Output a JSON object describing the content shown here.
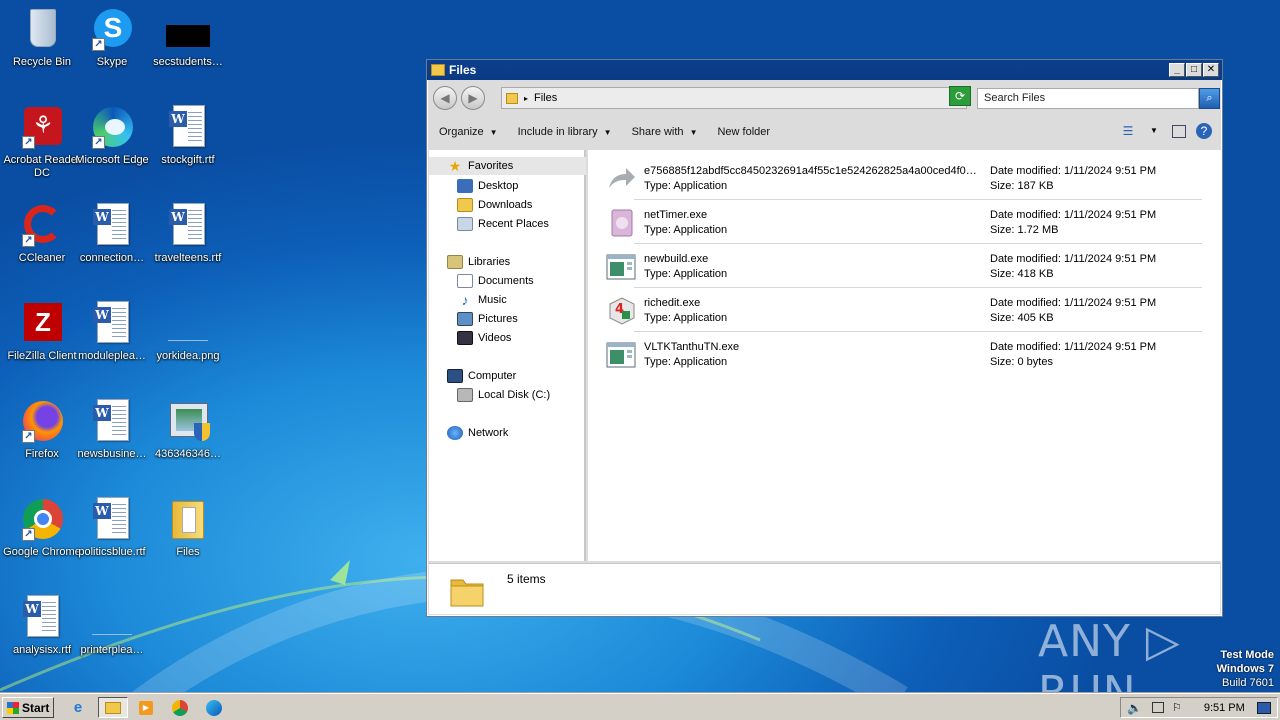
{
  "desktop": {
    "icons": [
      {
        "label": "Recycle Bin",
        "icon": "recycle-bin-icon"
      },
      {
        "label": "Skype",
        "icon": "skype-icon"
      },
      {
        "label": "secstudents…",
        "icon": "black-thumbnail-icon"
      },
      {
        "label": "Acrobat Reader DC",
        "icon": "acrobat-icon"
      },
      {
        "label": "Microsoft Edge",
        "icon": "edge-icon"
      },
      {
        "label": "stockgift.rtf",
        "icon": "word-document-icon"
      },
      {
        "label": "CCleaner",
        "icon": "ccleaner-icon"
      },
      {
        "label": "connection…",
        "icon": "word-document-icon"
      },
      {
        "label": "travelteens.rtf",
        "icon": "word-document-icon"
      },
      {
        "label": "FileZilla Client",
        "icon": "filezilla-icon"
      },
      {
        "label": "moduleplea…",
        "icon": "word-document-icon"
      },
      {
        "label": "yorkidea.png",
        "icon": "image-file-icon"
      },
      {
        "label": "Firefox",
        "icon": "firefox-icon"
      },
      {
        "label": "newsbusine…",
        "icon": "word-document-icon"
      },
      {
        "label": "436346346…",
        "icon": "installer-icon"
      },
      {
        "label": "Google Chrome",
        "icon": "chrome-icon"
      },
      {
        "label": "politicsblue.rtf",
        "icon": "word-document-icon"
      },
      {
        "label": "Files",
        "icon": "folder-icon"
      },
      {
        "label": "analysisx.rtf",
        "icon": "word-document-icon"
      },
      {
        "label": "printerplea…",
        "icon": "image-file-icon"
      }
    ]
  },
  "window": {
    "title": "Files",
    "minimize": "_",
    "maximize": "□",
    "close": "✕",
    "address": "Files",
    "search_placeholder": "Search Files",
    "toolbar": {
      "organize": "Organize",
      "include": "Include in library",
      "share": "Share with",
      "new_folder": "New folder"
    },
    "nav": {
      "favorites": "Favorites",
      "desktop": "Desktop",
      "downloads": "Downloads",
      "recent": "Recent Places",
      "libraries": "Libraries",
      "documents": "Documents",
      "music": "Music",
      "pictures": "Pictures",
      "videos": "Videos",
      "computer": "Computer",
      "local_disk": "Local Disk (C:)",
      "network": "Network"
    },
    "files": [
      {
        "name": "e756885f12abdf5cc8450232691a4f55c1e524262825a4a00ced4f0…",
        "type": "Type: Application",
        "modified": "Date modified: 1/11/2024 9:51 PM",
        "size": "Size: 187 KB"
      },
      {
        "name": "netTimer.exe",
        "type": "Type: Application",
        "modified": "Date modified: 1/11/2024 9:51 PM",
        "size": "Size: 1.72 MB"
      },
      {
        "name": "newbuild.exe",
        "type": "Type: Application",
        "modified": "Date modified: 1/11/2024 9:51 PM",
        "size": "Size: 418 KB"
      },
      {
        "name": "richedit.exe",
        "type": "Type: Application",
        "modified": "Date modified: 1/11/2024 9:51 PM",
        "size": "Size: 405 KB"
      },
      {
        "name": "VLTKTanthuTN.exe",
        "type": "Type: Application",
        "modified": "Date modified: 1/11/2024 9:51 PM",
        "size": "Size: 0 bytes"
      }
    ],
    "status": "5 items"
  },
  "taskbar": {
    "start": "Start",
    "clock": "9:51 PM"
  },
  "watermark": {
    "line1": "Test Mode",
    "line2": "Windows 7",
    "line3": "Build 7601",
    "brand": "ANY ▷ RUN"
  }
}
